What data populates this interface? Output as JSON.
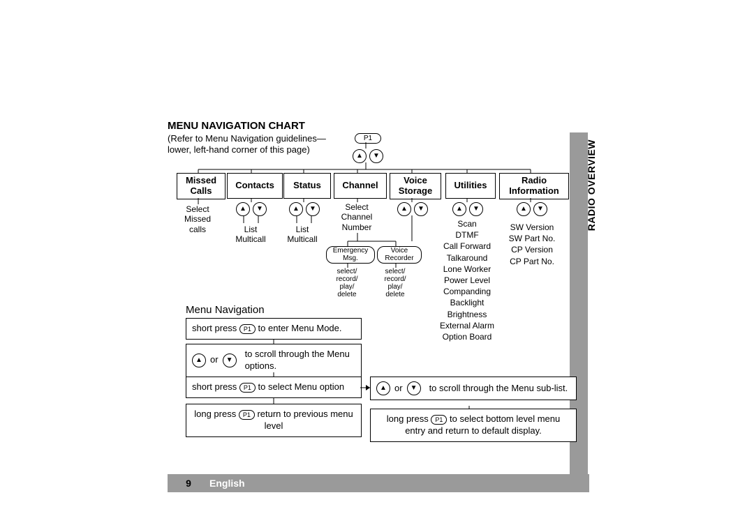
{
  "header": {
    "title": "MENU NAVIGATION CHART",
    "note1": "(Refer to Menu Navigation guidelines—",
    "note2": "lower, left-hand corner of this page)"
  },
  "root_button": "P1",
  "menus": {
    "missed": {
      "label_top": "Missed",
      "label_bot": "Calls",
      "sub": "Select\nMissed\ncalls"
    },
    "contacts": {
      "label": "Contacts",
      "sub": "List\nMulticall"
    },
    "status": {
      "label": "Status",
      "sub": "List\nMulticall"
    },
    "channel": {
      "label": "Channel",
      "sub": "Select\nChannel\nNumber",
      "emergency": "Emergency\nMsg.",
      "voice_rec": "Voice\nRecorder",
      "action1": "select/\nrecord/\nplay/\ndelete",
      "action2": "select/\nrecord/\nplay/\ndelete"
    },
    "voice": {
      "label_top": "Voice",
      "label_bot": "Storage"
    },
    "utilities": {
      "label": "Utilities",
      "items": [
        "Scan",
        "DTMF",
        "Call Forward",
        "Talkaround",
        "Lone Worker",
        "Power Level",
        "Companding",
        "Backlight",
        "Brightness",
        "External Alarm",
        "Option Board"
      ]
    },
    "radio": {
      "label_top": "Radio",
      "label_bot": "Information",
      "items": [
        "SW Version",
        "SW Part No.",
        "CP Version",
        "CP Part No."
      ]
    }
  },
  "guide": {
    "title": "Menu Navigation",
    "step1_a": "short press ",
    "step1_b": " to enter Menu Mode.",
    "step2_mid": " or ",
    "step2_txt": "to scroll through the Menu options.",
    "step3_a": "short press ",
    "step3_b": " to select Menu option",
    "step4_a": "long press ",
    "step4_b": " return to previous menu level",
    "step5_mid": " or ",
    "step5_txt": "to scroll through the Menu sub-list.",
    "step6_a": "long press ",
    "step6_b": " to select  bottom level menu entry and return to default display."
  },
  "tab": "RADIO OVERVIEW",
  "footer": {
    "page": "9",
    "lang": "English"
  }
}
